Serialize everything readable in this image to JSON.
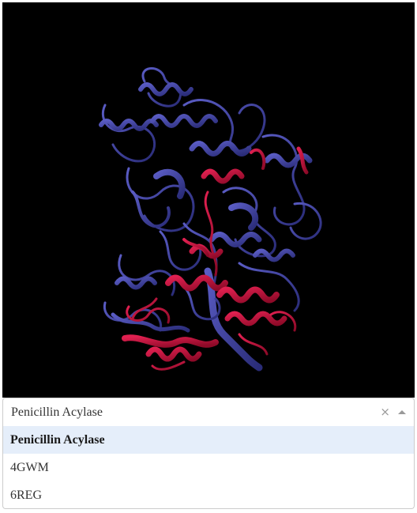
{
  "viewer": {
    "background": "#000000",
    "chain_colors": {
      "chain_a": "#3d3f9e",
      "chain_b": "#c8143c"
    }
  },
  "select": {
    "value": "Penicillin Acylase",
    "clear_icon": "×",
    "options": [
      {
        "label": "Penicillin Acylase",
        "selected": true
      },
      {
        "label": "4GWM",
        "selected": false
      },
      {
        "label": "6REG",
        "selected": false
      }
    ]
  }
}
